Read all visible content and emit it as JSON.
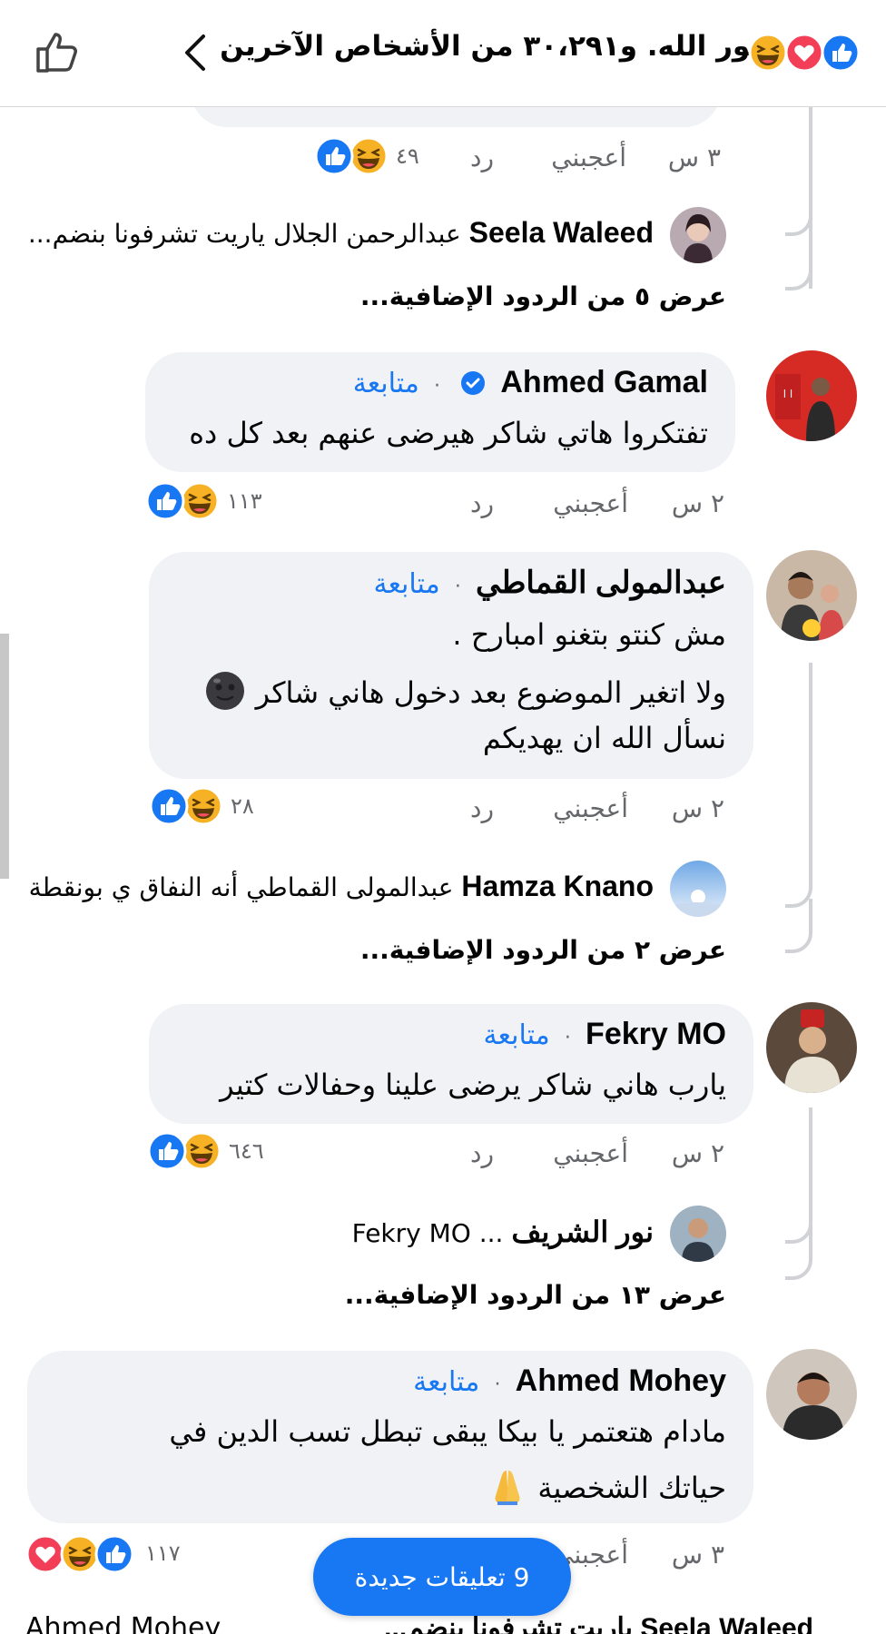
{
  "header": {
    "title": "نور الله. و٣٠،٢٩١ من الأشخاص الآخرين",
    "reaction_icons": [
      "like-icon",
      "love-icon",
      "haha-icon"
    ]
  },
  "colors": {
    "like": "#1877f2",
    "love": "#f33e58",
    "haha": "#f7b125",
    "bubble": "#f0f2f5",
    "link": "#1877f2",
    "muted": "#65676b"
  },
  "actions": {
    "like": "أعجبني",
    "reply": "رد"
  },
  "follow_label": "متابعة",
  "comments": [
    {
      "time": "٣ س",
      "reaction_count": "٤٩",
      "reactions": [
        "like-icon",
        "haha-icon"
      ],
      "replies": [
        {
          "name": "Seela Waleed",
          "text": "عبدالرحمن الجلال ياريت تشرفونا بنضم..."
        }
      ],
      "more_replies": "عرض ٥ من الردود الإضافية..."
    },
    {
      "name": "Ahmed Gamal",
      "verified": true,
      "lines": [
        "تفتكروا هاتي شاكر هيرضى عنهم بعد كل ده"
      ],
      "time": "٢ س",
      "reaction_count": "١١٣",
      "reactions": [
        "like-icon",
        "haha-icon"
      ]
    },
    {
      "name": "عبدالمولى القماطي",
      "lines": [
        "مش كنتو بتغنو امبارح .",
        "ولا اتغير الموضوع بعد دخول هاني شاكر",
        "نسأل الله ان يهديكم"
      ],
      "time": "٢ س",
      "reaction_count": "٢٨",
      "reactions": [
        "like-icon",
        "haha-icon"
      ],
      "replies": [
        {
          "name": "Hamza Knano",
          "text": "عبدالمولى القماطي أنه النفاق ي بونقطة"
        }
      ],
      "more_replies": "عرض ٢ من الردود الإضافية..."
    },
    {
      "name": "Fekry MO",
      "lines": [
        "يارب هاني شاكر يرضى علينا وحفالات كتير"
      ],
      "time": "٢ س",
      "reaction_count": "٦٤٦",
      "reactions": [
        "like-icon",
        "haha-icon"
      ],
      "replies": [
        {
          "name": "نور الشريف",
          "text": "... Fekry MO"
        }
      ],
      "more_replies": "عرض ١٣ من الردود الإضافية..."
    },
    {
      "name": "Ahmed Mohey",
      "lines": [
        "مادام هتعتمر يا بيكا يبقى تبطل تسب الدين في",
        "حياتك الشخصية"
      ],
      "time": "٣ س",
      "reaction_count": "١١٧",
      "reactions": [
        "like-icon",
        "haha-icon",
        "love-icon"
      ]
    }
  ],
  "new_comments_pill": "9 تعليقات جديدة",
  "bottom_partial": {
    "right": "Seela Waleed ياريت تشرفونا بنضم...",
    "left": "Ahmed Mohey"
  }
}
